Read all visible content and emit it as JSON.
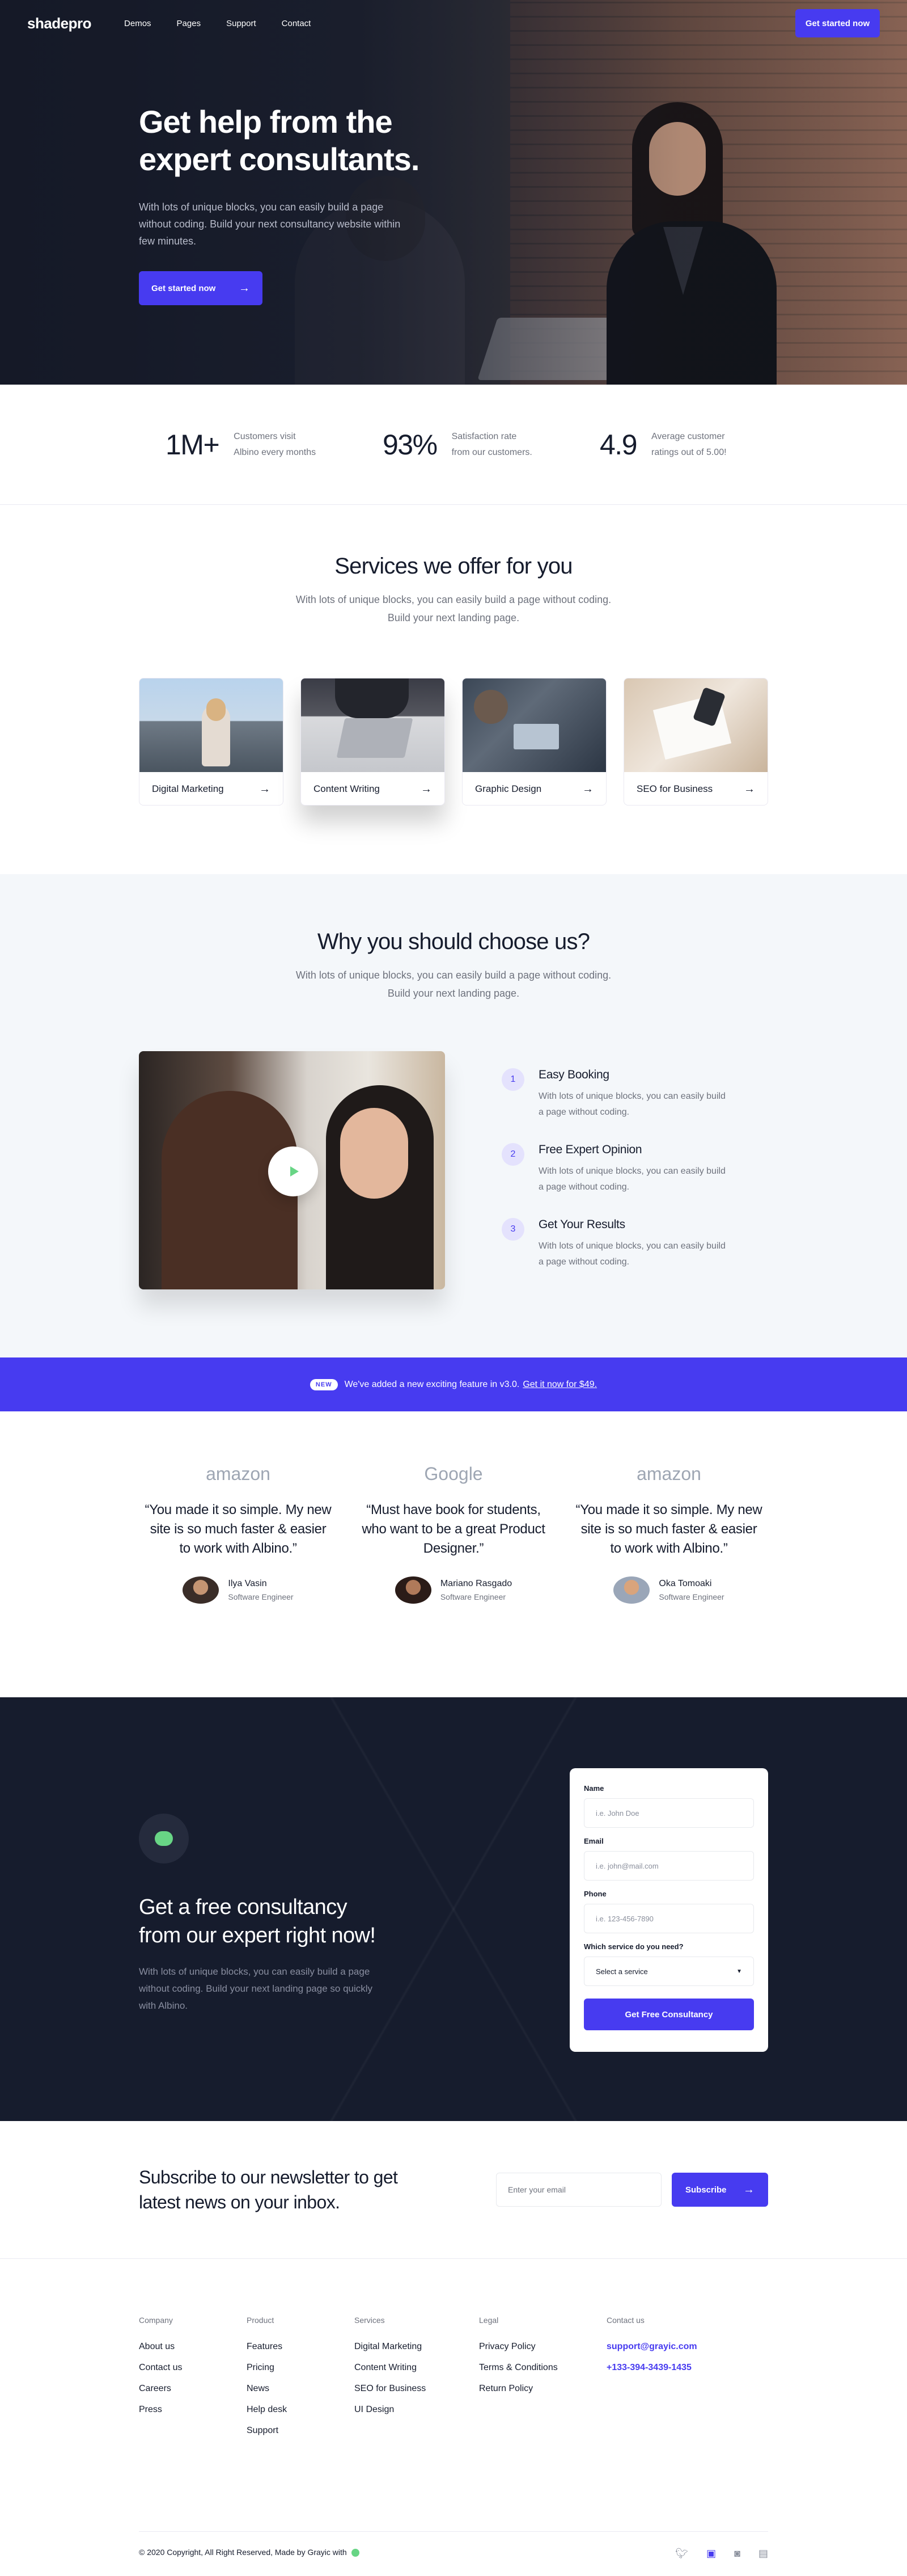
{
  "nav": {
    "logo": "shadepro",
    "items": [
      "Demos",
      "Pages",
      "Support",
      "Contact"
    ],
    "cta": "Get started now"
  },
  "hero": {
    "title_line1": "Get help from the",
    "title_line2": "expert consultants.",
    "desc": "With lots of unique blocks, you can easily build a page without coding. Build your next consultancy website within few minutes.",
    "cta": "Get started now"
  },
  "stats": [
    {
      "num": "1M+",
      "label": "Customers visit Albino every months"
    },
    {
      "num": "93%",
      "label": "Satisfaction rate from our customers."
    },
    {
      "num": "4.9",
      "label": "Average customer ratings out of 5.00!"
    }
  ],
  "services": {
    "title": "Services we offer for you",
    "sub": "With lots of unique blocks, you can easily build a page without coding. Build your next landing page.",
    "cards": [
      "Digital Marketing",
      "Content Writing",
      "Graphic Design",
      "SEO for Business"
    ]
  },
  "why": {
    "title": "Why you should choose us?",
    "sub": "With lots of unique blocks, you can easily build a page without coding. Build your next landing page.",
    "steps": [
      {
        "n": "1",
        "title": "Easy Booking",
        "desc": "With lots of unique blocks, you can easily build a page without coding."
      },
      {
        "n": "2",
        "title": "Free Expert Opinion",
        "desc": "With lots of unique blocks, you can easily build a page without coding."
      },
      {
        "n": "3",
        "title": "Get Your Results",
        "desc": "With lots of unique blocks, you can easily build a page without coding."
      }
    ]
  },
  "banner": {
    "badge": "NEW",
    "text": "We've added a new exciting feature in v3.0.",
    "link": "Get it now for $49."
  },
  "testimonials": [
    {
      "brand": "amazon",
      "quote": "“You made it so simple. My new site is so much faster & easier to work with Albino.”",
      "name": "Ilya Vasin",
      "role": "Software Engineer"
    },
    {
      "brand": "Google",
      "quote": "“Must have book for students, who want to be a great Product Designer.”",
      "name": "Mariano Rasgado",
      "role": "Software Engineer"
    },
    {
      "brand": "amazon",
      "quote": "“You made it so simple. My new site is so much faster & easier to work with Albino.”",
      "name": "Oka Tomoaki",
      "role": "Software Engineer"
    }
  ],
  "consult": {
    "title": "Get a free consultancy from our expert right now!",
    "desc": "With lots of unique blocks, you can easily build a page without coding. Build your next landing page so quickly with Albino.",
    "form": {
      "name_label": "Name",
      "name_ph": "i.e. John Doe",
      "email_label": "Email",
      "email_ph": "i.e. john@mail.com",
      "phone_label": "Phone",
      "phone_ph": "i.e. 123-456-7890",
      "service_label": "Which service do you need?",
      "service_value": "Select a service",
      "submit": "Get Free Consultancy"
    }
  },
  "newsletter": {
    "title": "Subscribe to our newsletter to get latest news on your inbox.",
    "placeholder": "Enter your email",
    "button": "Subscribe"
  },
  "footer": {
    "cols": [
      {
        "title": "Company",
        "items": [
          "About us",
          "Contact us",
          "Careers",
          "Press"
        ]
      },
      {
        "title": "Product",
        "items": [
          "Features",
          "Pricing",
          "News",
          "Help desk",
          "Support"
        ]
      },
      {
        "title": "Services",
        "items": [
          "Digital Marketing",
          "Content Writing",
          "SEO for Business",
          "UI Design"
        ]
      },
      {
        "title": "Legal",
        "items": [
          "Privacy Policy",
          "Terms & Conditions",
          "Return Policy"
        ]
      },
      {
        "title": "Contact us",
        "items": [
          "support@grayic.com",
          "+133-394-3439-1435"
        ]
      }
    ],
    "copyright": "© 2020 Copyright, All Right Reserved, Made by Grayic with",
    "socials": [
      "twitter-icon",
      "facebook-icon",
      "instagram-icon",
      "linkedin-icon"
    ]
  },
  "colors": {
    "primary": "#473bf0",
    "dark": "#161c2d",
    "green": "#68d585",
    "light": "#f4f7fa"
  }
}
